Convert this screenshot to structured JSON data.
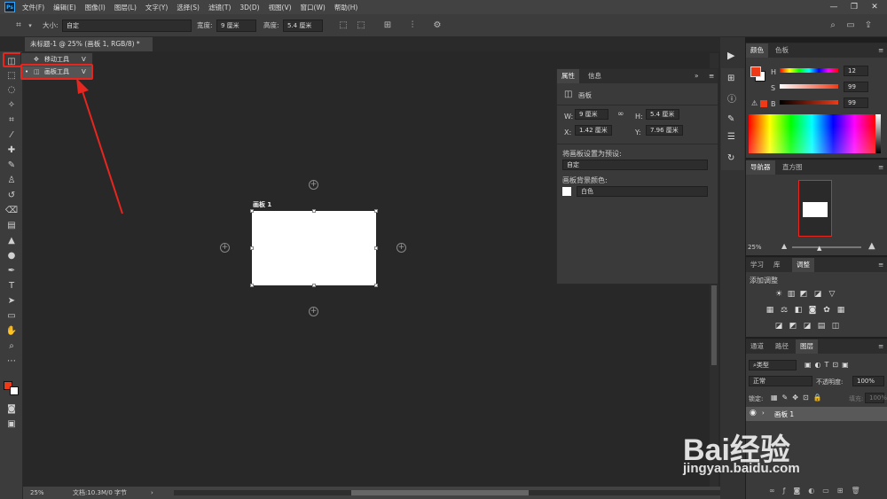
{
  "app": {
    "logo": "Ps"
  },
  "menu": [
    "文件(F)",
    "编辑(E)",
    "图像(I)",
    "图层(L)",
    "文字(Y)",
    "选择(S)",
    "滤镜(T)",
    "3D(D)",
    "视图(V)",
    "窗口(W)",
    "帮助(H)"
  ],
  "window_controls": {
    "minimize": "—",
    "restore": "❐",
    "close": "✕"
  },
  "options_bar": {
    "size_label": "大小:",
    "size_value": "自定",
    "width_label": "宽度:",
    "width_value": "9 厘米",
    "height_label": "高度:",
    "height_value": "5.4 厘米"
  },
  "document": {
    "tab_title": "未标题-1 @ 25% (画板 1, RGB/8) *",
    "tab_close": "×",
    "artboard_label": "画板 1"
  },
  "flyout": {
    "item1": "移动工具",
    "item1_key": "V",
    "item2": "画板工具",
    "item2_key": "V"
  },
  "status": {
    "zoom": "25%",
    "doc_info": "文档:10.3M/0 字节",
    "arrow": "›"
  },
  "properties": {
    "tab_properties": "属性",
    "tab_info": "信息",
    "section": "画板",
    "w_label": "W:",
    "w_value": "9 厘米",
    "h_label": "H:",
    "h_value": "5.4 厘米",
    "x_label": "X:",
    "x_value": "1.42 厘米",
    "y_label": "Y:",
    "y_value": "7.96 厘米",
    "preset_label": "将画板设置为预设:",
    "preset_value": "自定",
    "bg_label": "画板背景颜色:",
    "bg_value": "白色"
  },
  "color_panel": {
    "tab_color": "颜色",
    "tab_swatches": "色板",
    "h_label": "H",
    "h_value": "12",
    "s_label": "S",
    "s_value": "99",
    "b_label": "B",
    "b_value": "99",
    "fg_color": "#ee3a17",
    "bg_color": "#ffffff"
  },
  "navigator": {
    "tab_nav": "导航器",
    "tab_hist": "直方图",
    "zoom": "25%"
  },
  "adjust": {
    "tab_learn": "学习",
    "tab_lib": "库",
    "tab_adjust": "调整",
    "title": "添加调整"
  },
  "layers": {
    "tab_channels": "通道",
    "tab_paths": "路径",
    "tab_layers": "图层",
    "filter": "类型",
    "blend": "正常",
    "opacity_label": "不透明度:",
    "opacity_value": "100%",
    "lock_label": "锁定:",
    "fill_label": "填充:",
    "fill_value": "100%",
    "layer_name": "画板 1"
  },
  "watermark": {
    "line1": "Bai经验",
    "line2": "jingyan.baidu.com"
  },
  "colors": {
    "accent_red": "#e6261f",
    "ui_bg": "#3a3a3a",
    "canvas": "#282828"
  }
}
